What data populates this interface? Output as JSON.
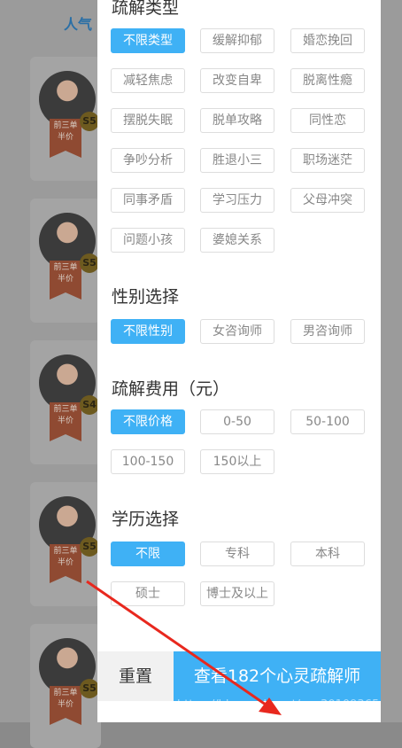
{
  "background": {
    "tab_label": "人气",
    "cards": [
      {
        "ribbon_line1": "前三单",
        "ribbon_line2": "半价",
        "level": "S5"
      },
      {
        "ribbon_line1": "前三单",
        "ribbon_line2": "半价",
        "level": "S5"
      },
      {
        "ribbon_line1": "前三单",
        "ribbon_line2": "半价",
        "level": "S4"
      },
      {
        "ribbon_line1": "前三单",
        "ribbon_line2": "半价",
        "level": "S5"
      },
      {
        "ribbon_line1": "前三单",
        "ribbon_line2": "半价",
        "level": "S5"
      }
    ]
  },
  "filters": {
    "type": {
      "title": "疏解类型",
      "options": [
        "不限类型",
        "缓解抑郁",
        "婚恋挽回",
        "减轻焦虑",
        "改变自卑",
        "脱离性瘾",
        "摆脱失眠",
        "脱单攻略",
        "同性恋",
        "争吵分析",
        "胜退小三",
        "职场迷茫",
        "同事矛盾",
        "学习压力",
        "父母冲突",
        "问题小孩",
        "婆媳关系"
      ],
      "selected": "不限类型"
    },
    "gender": {
      "title": "性别选择",
      "options": [
        "不限性别",
        "女咨询师",
        "男咨询师"
      ],
      "selected": "不限性别"
    },
    "fee": {
      "title": "疏解费用（元）",
      "options": [
        "不限价格",
        "0-50",
        "50-100",
        "100-150",
        "150以上"
      ],
      "selected": "不限价格"
    },
    "education": {
      "title": "学历选择",
      "options": [
        "不限",
        "专科",
        "本科",
        "硕士",
        "博士及以上"
      ],
      "selected": "不限"
    }
  },
  "footer": {
    "reset_label": "重置",
    "submit_label": "查看182个心灵疏解师"
  },
  "watermark": "https://blog.csdn.net/qq_30109365",
  "colors": {
    "accent": "#3fb1f5",
    "annotation_arrow": "#e8281e"
  }
}
